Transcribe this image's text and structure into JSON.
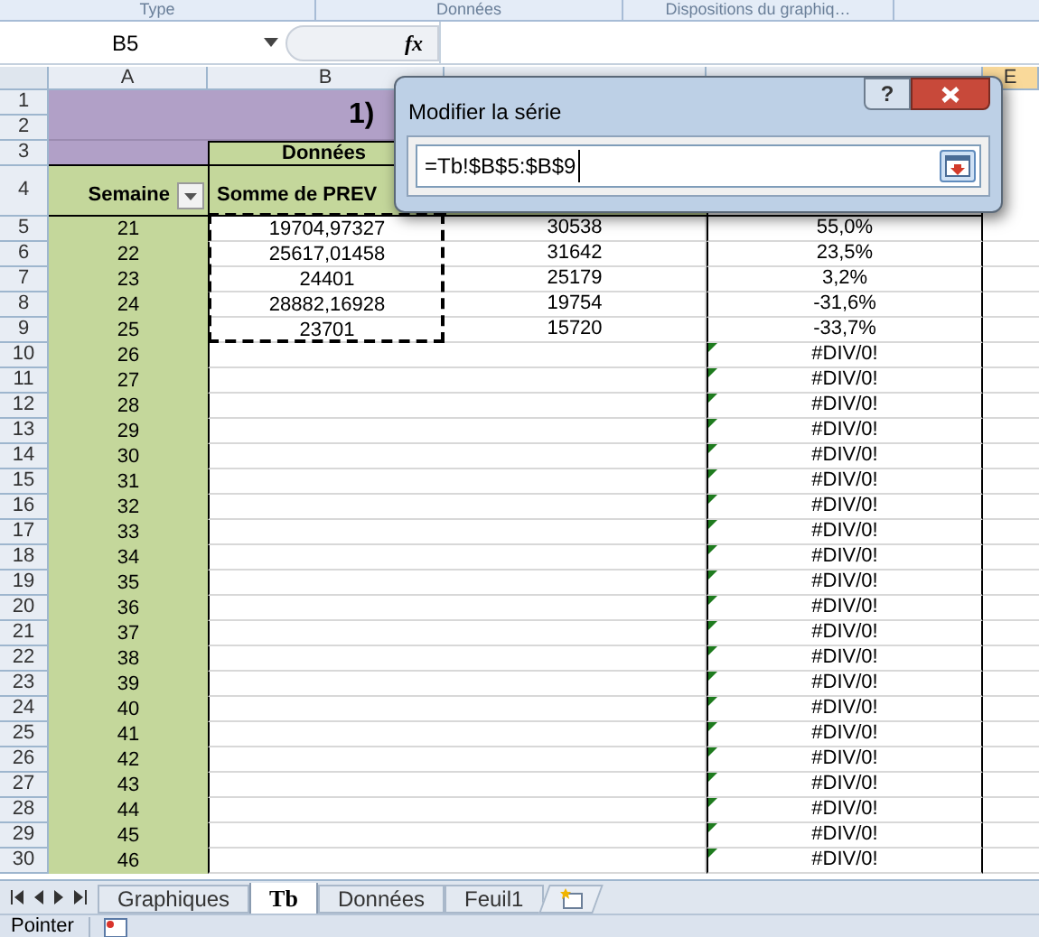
{
  "ribbon_groups": [
    "Type",
    "Données",
    "Dispositions du graphiq…"
  ],
  "formula_bar": {
    "name_box": "B5",
    "fx": "fx"
  },
  "columns": [
    "A",
    "B",
    "E"
  ],
  "top_rows": [
    "1",
    "2",
    "3",
    "4"
  ],
  "title": "1)",
  "header_group": "Données",
  "headers": [
    {
      "label": "Semaine",
      "filter": true
    },
    {
      "label": "Somme de PREV",
      "filter": false
    }
  ],
  "rows": [
    {
      "number": "5",
      "week": "21",
      "b": "19704,97327",
      "c": "30538",
      "d": "55,0%",
      "error": false,
      "in_selection": true
    },
    {
      "number": "6",
      "week": "22",
      "b": "25617,01458",
      "c": "31642",
      "d": "23,5%",
      "error": false,
      "in_selection": true
    },
    {
      "number": "7",
      "week": "23",
      "b": "24401",
      "c": "25179",
      "d": "3,2%",
      "error": false,
      "in_selection": true
    },
    {
      "number": "8",
      "week": "24",
      "b": "28882,16928",
      "c": "19754",
      "d": "-31,6%",
      "error": false,
      "in_selection": true
    },
    {
      "number": "9",
      "week": "25",
      "b": "23701",
      "c": "15720",
      "d": "-33,7%",
      "error": false,
      "in_selection": true
    },
    {
      "number": "10",
      "week": "26",
      "d": "#DIV/0!",
      "error": true,
      "in_selection": false
    },
    {
      "number": "11",
      "week": "27",
      "d": "#DIV/0!",
      "error": true,
      "in_selection": false
    },
    {
      "number": "12",
      "week": "28",
      "d": "#DIV/0!",
      "error": true,
      "in_selection": false
    },
    {
      "number": "13",
      "week": "29",
      "d": "#DIV/0!",
      "error": true,
      "in_selection": false
    },
    {
      "number": "14",
      "week": "30",
      "d": "#DIV/0!",
      "error": true,
      "in_selection": false
    },
    {
      "number": "15",
      "week": "31",
      "d": "#DIV/0!",
      "error": true,
      "in_selection": false
    },
    {
      "number": "16",
      "week": "32",
      "d": "#DIV/0!",
      "error": true,
      "in_selection": false
    },
    {
      "number": "17",
      "week": "33",
      "d": "#DIV/0!",
      "error": true,
      "in_selection": false
    },
    {
      "number": "18",
      "week": "34",
      "d": "#DIV/0!",
      "error": true,
      "in_selection": false
    },
    {
      "number": "19",
      "week": "35",
      "d": "#DIV/0!",
      "error": true,
      "in_selection": false
    },
    {
      "number": "20",
      "week": "36",
      "d": "#DIV/0!",
      "error": true,
      "in_selection": false
    },
    {
      "number": "21",
      "week": "37",
      "d": "#DIV/0!",
      "error": true,
      "in_selection": false
    },
    {
      "number": "22",
      "week": "38",
      "d": "#DIV/0!",
      "error": true,
      "in_selection": false
    },
    {
      "number": "23",
      "week": "39",
      "d": "#DIV/0!",
      "error": true,
      "in_selection": false
    },
    {
      "number": "24",
      "week": "40",
      "d": "#DIV/0!",
      "error": true,
      "in_selection": false
    },
    {
      "number": "25",
      "week": "41",
      "d": "#DIV/0!",
      "error": true,
      "in_selection": false
    },
    {
      "number": "26",
      "week": "42",
      "d": "#DIV/0!",
      "error": true,
      "in_selection": false
    },
    {
      "number": "27",
      "week": "43",
      "d": "#DIV/0!",
      "error": true,
      "in_selection": false
    },
    {
      "number": "28",
      "week": "44",
      "d": "#DIV/0!",
      "error": true,
      "in_selection": false
    },
    {
      "number": "29",
      "week": "45",
      "d": "#DIV/0!",
      "error": true,
      "in_selection": false
    },
    {
      "number": "30",
      "week": "46",
      "d": "#DIV/0!",
      "error": true,
      "in_selection": false
    }
  ],
  "dialog": {
    "title": "Modifier la série",
    "help": "?",
    "value": "=Tb!$B$5:$B$9"
  },
  "sheet_tabs": [
    {
      "label": "Graphiques",
      "selected": false
    },
    {
      "label": "Tb",
      "selected": true
    },
    {
      "label": "Données",
      "selected": false
    },
    {
      "label": "Feuil1",
      "selected": false
    }
  ],
  "status_bar": {
    "mode": "Pointer"
  }
}
